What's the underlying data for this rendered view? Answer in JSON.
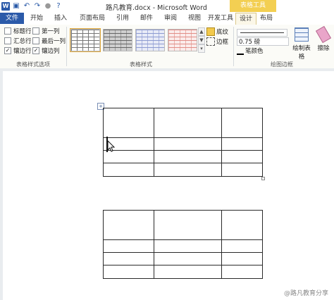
{
  "window": {
    "title": "路凡教育.docx - Microsoft Word",
    "context_tab_group": "表格工具"
  },
  "tabs": [
    "文件",
    "开始",
    "插入",
    "页面布局",
    "引用",
    "邮件",
    "审阅",
    "视图",
    "开发工具",
    "设计",
    "布局"
  ],
  "ribbon": {
    "style_options": {
      "group_label": "表格样式选项",
      "options": [
        {
          "label": "标题行",
          "checked": false
        },
        {
          "label": "第一列",
          "checked": false
        },
        {
          "label": "汇总行",
          "checked": false
        },
        {
          "label": "最后一列",
          "checked": false
        },
        {
          "label": "镶边行",
          "checked": true
        },
        {
          "label": "镶边列",
          "checked": true
        }
      ]
    },
    "table_styles": {
      "group_label": "表格样式",
      "shading_label": "底纹",
      "borders_label": "边框"
    },
    "draw_borders": {
      "group_label": "绘图边框",
      "line_weight": "0.75 磅",
      "pen_color_label": "笔颜色",
      "draw_table_label": "绘制表格",
      "eraser_label": "擦除"
    }
  },
  "watermark": "@路凡教育分享",
  "colors": {
    "file_tab": "#2b5aa9",
    "context_tab": "#f3cf52"
  },
  "icons": [
    "word-icon",
    "save-icon",
    "undo-icon",
    "redo-icon",
    "repeat-icon",
    "help-icon",
    "table-move-handle-icon",
    "mouse-cursor-icon",
    "shading-icon",
    "borders-icon",
    "pen-color-icon",
    "draw-table-icon",
    "eraser-icon"
  ]
}
